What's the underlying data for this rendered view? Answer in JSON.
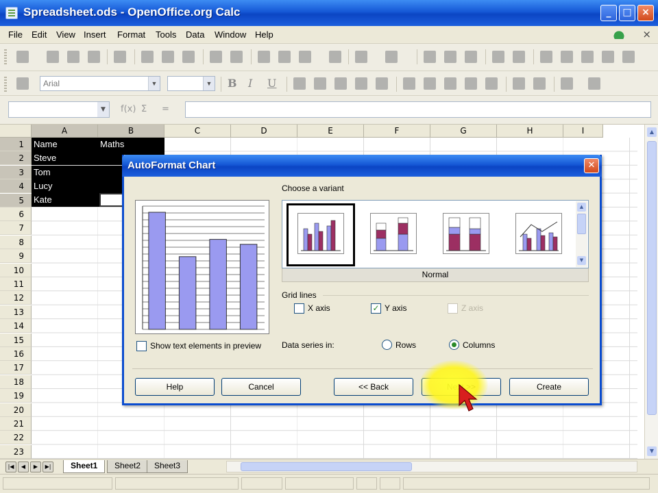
{
  "window": {
    "title": "Spreadsheet.ods - OpenOffice.org Calc",
    "min": "_",
    "max": "□",
    "close": "×"
  },
  "menu": [
    "File",
    "Edit",
    "View",
    "Insert",
    "Format",
    "Tools",
    "Data",
    "Window",
    "Help"
  ],
  "menu_close": "×",
  "font_box": {
    "font": "Arial",
    "size": ""
  },
  "columns": [
    "A",
    "B",
    "C",
    "D",
    "E",
    "F",
    "G",
    "H",
    "I"
  ],
  "rows": [
    "1",
    "2",
    "3",
    "4",
    "5",
    "6",
    "7",
    "8",
    "9",
    "10",
    "11",
    "12",
    "13",
    "14",
    "15",
    "16",
    "17",
    "18",
    "19",
    "20",
    "21",
    "22",
    "23"
  ],
  "cells": {
    "A1": "Name",
    "B1": "Maths",
    "A2": "Steve",
    "A3": "Tom",
    "A4": "Lucy",
    "A5": "Kate"
  },
  "sheet_tabs": [
    "Sheet1",
    "Sheet2",
    "Sheet3"
  ],
  "dialog": {
    "title": "AutoFormat Chart",
    "choose_variant_label": "Choose a variant",
    "variant_name": "Normal",
    "grid_lines_label": "Grid lines",
    "x_axis": "X axis",
    "y_axis": "Y axis",
    "z_axis": "Z axis",
    "show_text_label": "Show text elements in preview",
    "data_series_label": "Data series in:",
    "rows_option": "Rows",
    "columns_option": "Columns",
    "buttons": {
      "help": "Help",
      "cancel": "Cancel",
      "back": "<< Back",
      "next": "Next >>",
      "create": "Create"
    },
    "x_axis_checked": false,
    "y_axis_checked": true,
    "show_text_checked": false,
    "selected_series": "columns"
  },
  "colors": {
    "selection": "#000000",
    "bar_fill": "#9a9af0",
    "titlebar": "#0b45c4",
    "highlight": "#ffff28"
  },
  "preview_bars": [
    0.95,
    0.59,
    0.73,
    0.69
  ]
}
